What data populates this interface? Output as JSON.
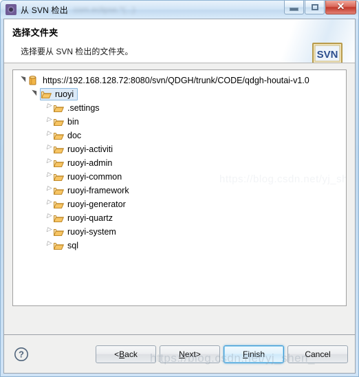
{
  "window": {
    "title": "从 SVN 检出",
    "title_blurred_suffix": "com.eclipse.*(...)",
    "icon": "svn-checkout-icon",
    "controls": {
      "minimize": "minimize-button",
      "maximize": "maximize-button",
      "close": "close-button",
      "close_glyph": "✕"
    }
  },
  "header": {
    "title": "选择文件夹",
    "subtitle": "选择要从 SVN 检出的文件夹。",
    "logo_text": "SVN"
  },
  "tree": {
    "nodes": [
      {
        "label": "https://192.168.128.72:8080/svn/QDGH/trunk/CODE/qdgh-houtai-v1.0",
        "icon": "repository-icon",
        "depth": 0,
        "expanded": true,
        "selected": false
      },
      {
        "label": "ruoyi",
        "icon": "folder-icon",
        "depth": 1,
        "expanded": true,
        "selected": true
      },
      {
        "label": ".settings",
        "icon": "folder-icon",
        "depth": 2,
        "expanded": false,
        "selected": false
      },
      {
        "label": "bin",
        "icon": "folder-icon",
        "depth": 2,
        "expanded": false,
        "selected": false
      },
      {
        "label": "doc",
        "icon": "folder-icon",
        "depth": 2,
        "expanded": false,
        "selected": false
      },
      {
        "label": "ruoyi-activiti",
        "icon": "folder-icon",
        "depth": 2,
        "expanded": false,
        "selected": false
      },
      {
        "label": "ruoyi-admin",
        "icon": "folder-icon",
        "depth": 2,
        "expanded": false,
        "selected": false
      },
      {
        "label": "ruoyi-common",
        "icon": "folder-icon",
        "depth": 2,
        "expanded": false,
        "selected": false
      },
      {
        "label": "ruoyi-framework",
        "icon": "folder-icon",
        "depth": 2,
        "expanded": false,
        "selected": false
      },
      {
        "label": "ruoyi-generator",
        "icon": "folder-icon",
        "depth": 2,
        "expanded": false,
        "selected": false
      },
      {
        "label": "ruoyi-quartz",
        "icon": "folder-icon",
        "depth": 2,
        "expanded": false,
        "selected": false
      },
      {
        "label": "ruoyi-system",
        "icon": "folder-icon",
        "depth": 2,
        "expanded": false,
        "selected": false
      },
      {
        "label": "sql",
        "icon": "folder-icon",
        "depth": 2,
        "expanded": false,
        "selected": false
      }
    ]
  },
  "footer": {
    "help": "?",
    "buttons": {
      "back": {
        "prefix": "< ",
        "mnemonic": "B",
        "rest": "ack"
      },
      "next": {
        "mnemonic": "N",
        "rest": "ext",
        "suffix": " >"
      },
      "finish": {
        "mnemonic": "F",
        "rest": "inish",
        "is_default": true
      },
      "cancel": {
        "label": "Cancel"
      }
    }
  },
  "watermark": {
    "text": "https://blog.csdn.net/yj_shen_"
  },
  "colors": {
    "accent": "#3c9ad6",
    "folder": "#f0b556",
    "selection": "#dceaf7",
    "titlebar": "#cfe2f5"
  }
}
